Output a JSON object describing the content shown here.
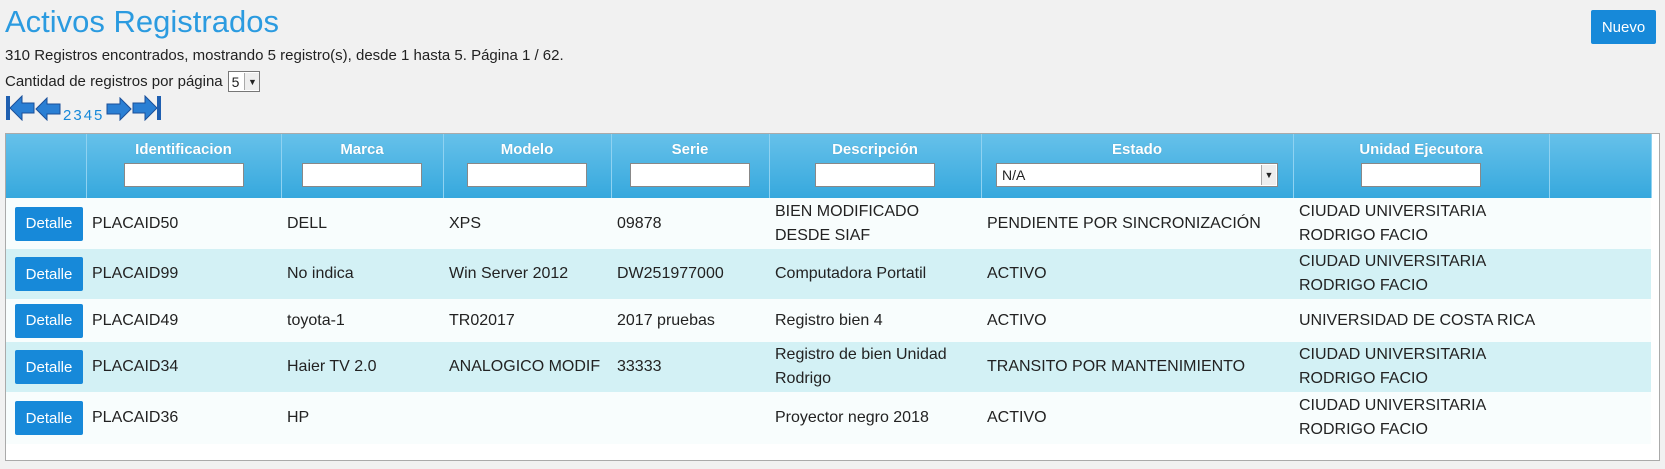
{
  "header": {
    "title": "Activos Registrados",
    "new_label": "Nuevo",
    "summary": "310 Registros encontrados, mostrando 5 registro(s), desde 1 hasta 5. Página 1 / 62.",
    "per_page_label": "Cantidad de registros por página",
    "per_page_value": "5"
  },
  "pager": {
    "pages": [
      "2",
      "3",
      "4",
      "5"
    ]
  },
  "table": {
    "columns": [
      "Identificacion",
      "Marca",
      "Modelo",
      "Serie",
      "Descripción",
      "Estado",
      "Unidad Ejecutora"
    ],
    "estado_filter_value": "N/A",
    "detail_label": "Detalle",
    "rows": [
      {
        "id": "PLACAID50",
        "marca": "DELL",
        "modelo": "XPS",
        "serie": "09878",
        "descripcion": "BIEN MODIFICADO DESDE SIAF",
        "estado": "PENDIENTE POR SINCRONIZACIÓN",
        "unidad": "CIUDAD UNIVERSITARIA RODRIGO FACIO"
      },
      {
        "id": "PLACAID99",
        "marca": "No indica",
        "modelo": "Win Server 2012",
        "serie": "DW251977000",
        "descripcion": "Computadora Portatil",
        "estado": "ACTIVO",
        "unidad": "CIUDAD UNIVERSITARIA RODRIGO FACIO"
      },
      {
        "id": "PLACAID49",
        "marca": "toyota-1",
        "modelo": "TR02017",
        "serie": "2017 pruebas",
        "descripcion": "Registro bien 4",
        "estado": "ACTIVO",
        "unidad": "UNIVERSIDAD DE COSTA RICA"
      },
      {
        "id": "PLACAID34",
        "marca": "Haier TV 2.0",
        "modelo": "ANALOGICO MODIF",
        "serie": "33333",
        "descripcion": "Registro de bien Unidad Rodrigo",
        "estado": "TRANSITO POR MANTENIMIENTO",
        "unidad": "CIUDAD UNIVERSITARIA RODRIGO FACIO"
      },
      {
        "id": "PLACAID36",
        "marca": "HP",
        "modelo": "",
        "serie": "",
        "descripcion": "Proyector negro 2018",
        "estado": "ACTIVO",
        "unidad": "CIUDAD UNIVERSITARIA RODRIGO FACIO"
      }
    ]
  },
  "colors": {
    "accent": "#2b9be0",
    "button": "#1789d9",
    "row_alt": "#d3f1f5"
  },
  "icons": [
    "first-page-icon",
    "prev-page-icon",
    "next-page-icon",
    "last-page-icon",
    "chevron-down-icon"
  ]
}
